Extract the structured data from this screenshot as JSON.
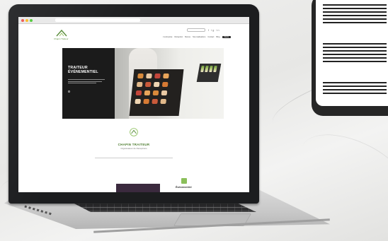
{
  "website": {
    "nav_items": [
      "L'entreprise",
      "Réception",
      "Menus",
      "Nos réalisations",
      "Contact",
      "Blog"
    ],
    "nav_cta": "Devis",
    "header_icons": "f  ig  in",
    "logo_text": "Chapin Traiteur",
    "hero_title": "TRAITEUR ÉVÉNEMENTIEL",
    "brand_name": "CHAPIN TRAITEUR",
    "brand_sub": "Organisateur de Réceptions",
    "thumb_text": "Événementiel"
  },
  "colors": {
    "accent_green": "#5b8e3e",
    "hero_dark": "#1b1b1b",
    "laptop_bezel": "#1c1d1f"
  }
}
